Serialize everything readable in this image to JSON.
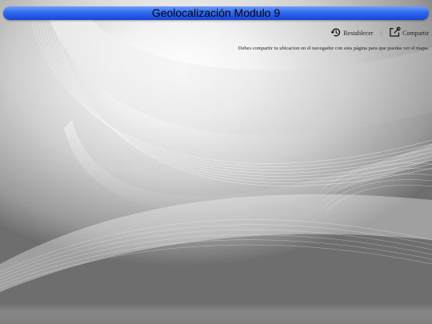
{
  "header": {
    "title": "Geolocalización Modulo 9"
  },
  "toolbar": {
    "reset_label": "Restablecer",
    "separator": "|",
    "share_label": "Compartir",
    "reset_icon": "history-icon",
    "share_icon": "share-icon"
  },
  "main": {
    "message": "Debes compartir tu ubicacion en el navegador con esta página para que puedas ver el mapa."
  },
  "colors": {
    "title_bar": "#2f68ee",
    "background_light": "#ffffff",
    "background_dark": "#6e6e6e"
  }
}
